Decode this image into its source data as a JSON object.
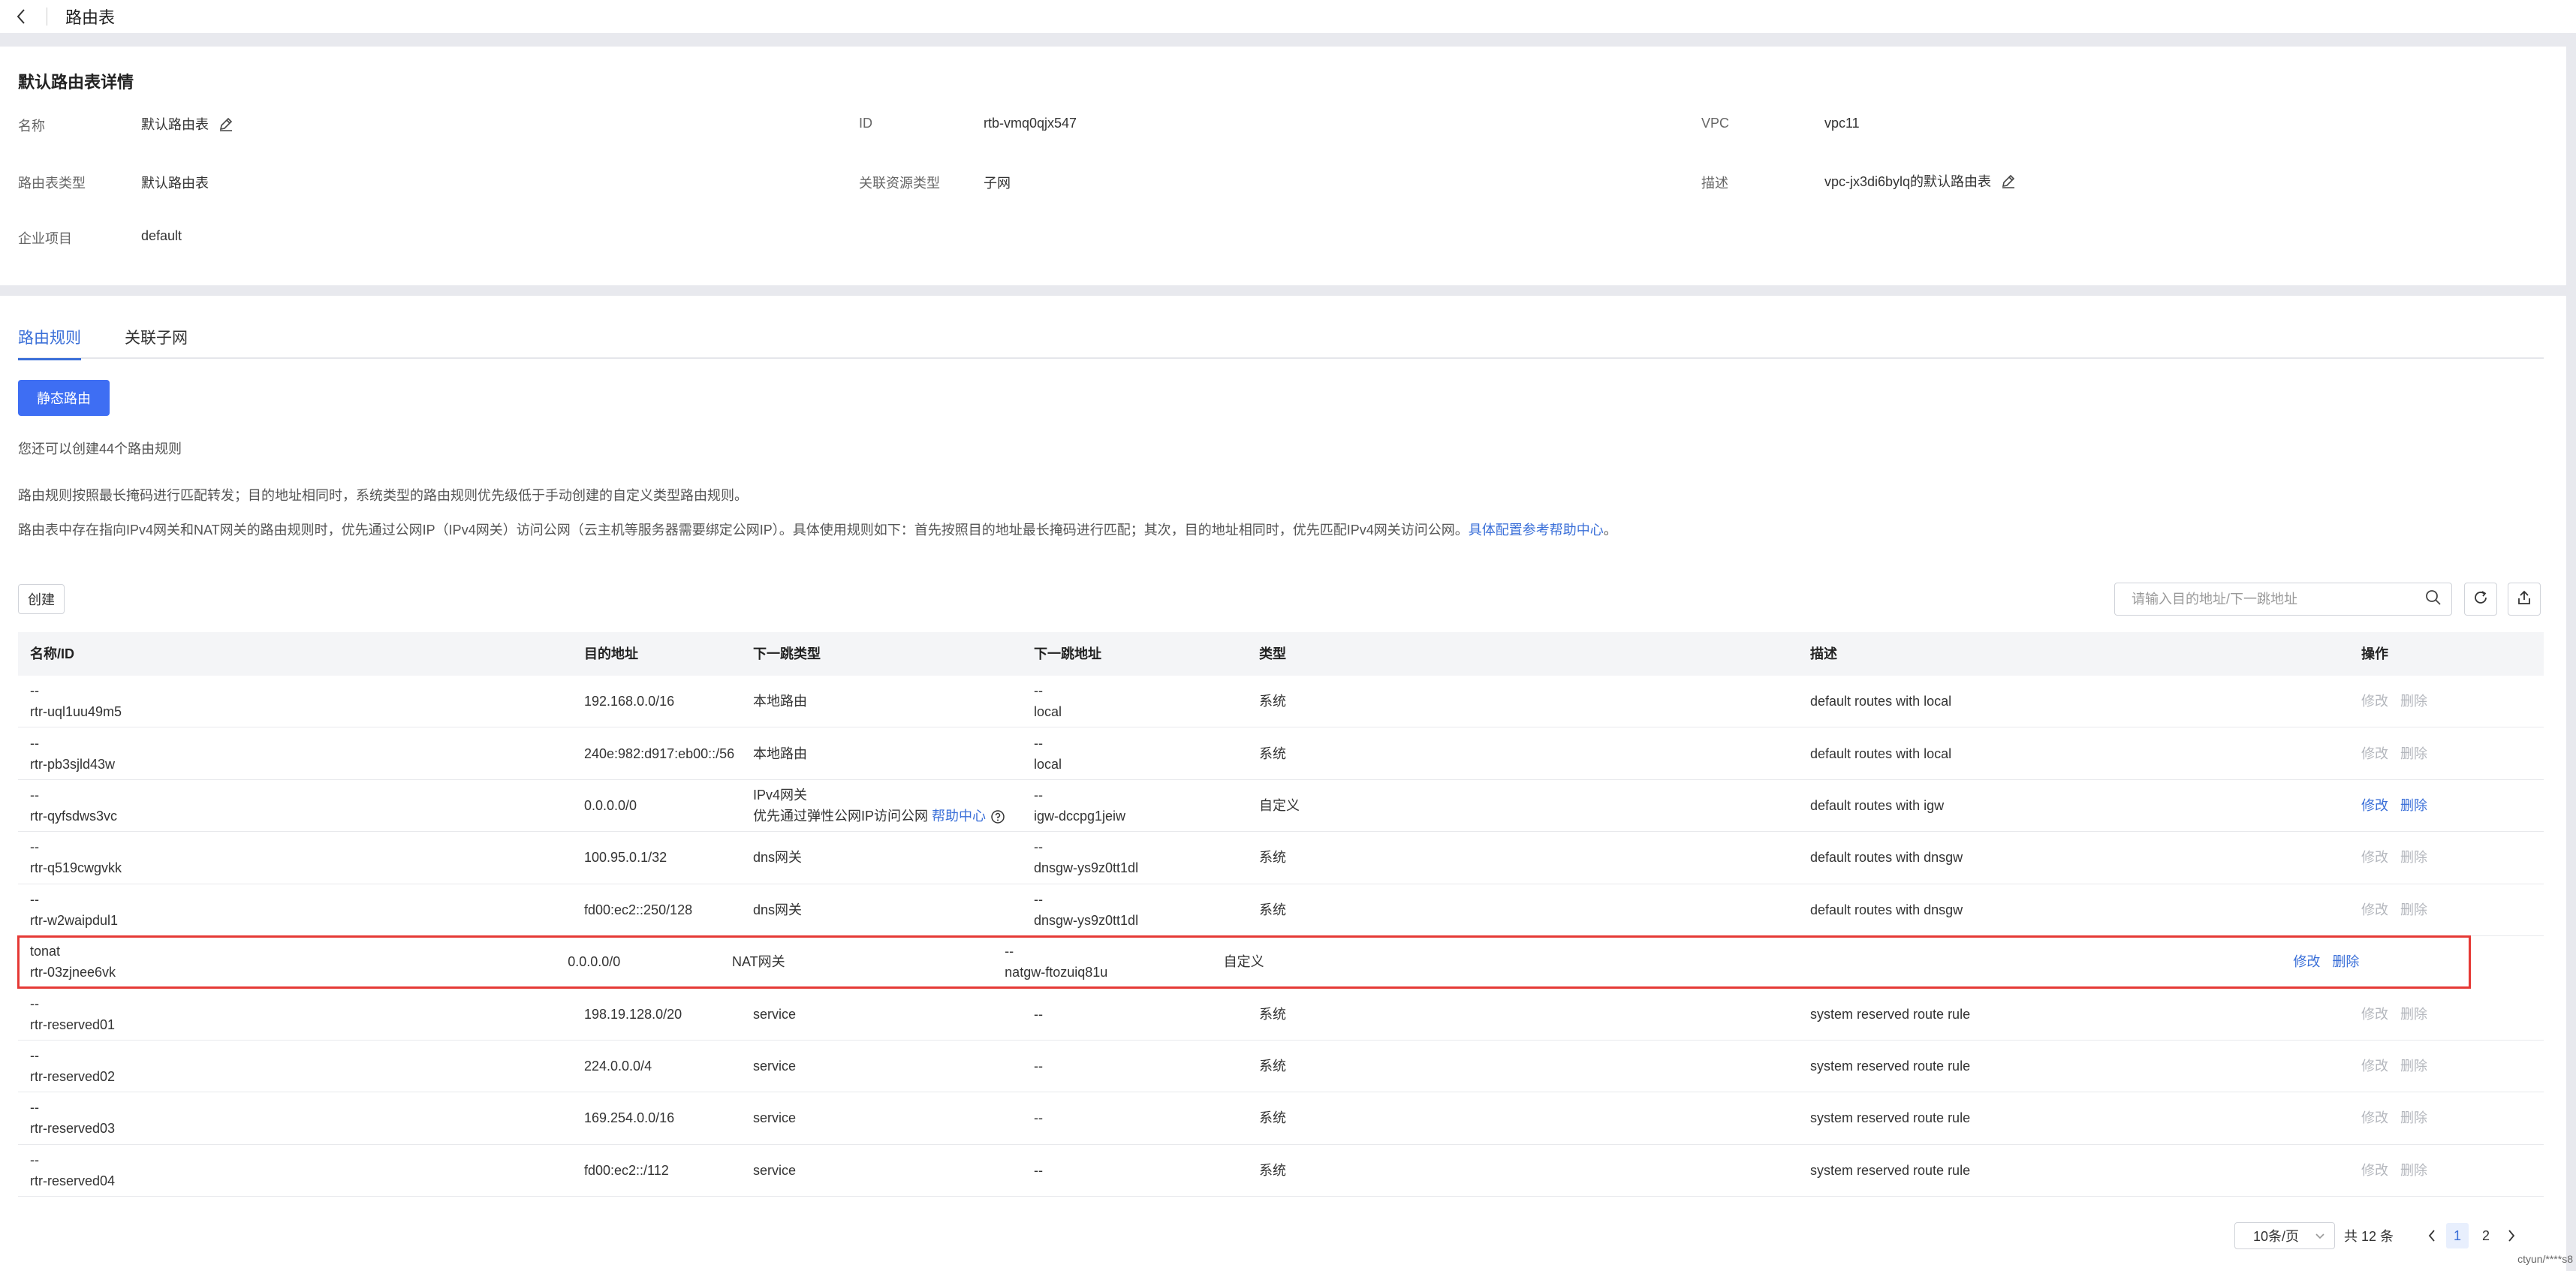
{
  "header": {
    "title": "路由表"
  },
  "detail": {
    "title": "默认路由表详情",
    "name_label": "名称",
    "name_value": "默认路由表",
    "id_label": "ID",
    "id_value": "rtb-vmq0qjx547",
    "vpc_label": "VPC",
    "vpc_value": "vpc11",
    "type_label": "路由表类型",
    "type_value": "默认路由表",
    "res_label": "关联资源类型",
    "res_value": "子网",
    "desc_label": "描述",
    "desc_value": "vpc-jx3di6bylq的默认路由表",
    "proj_label": "企业项目",
    "proj_value": "default"
  },
  "tabs": [
    {
      "label": "路由规则",
      "active": true
    },
    {
      "label": "关联子网",
      "active": false
    }
  ],
  "static_route_button": "静态路由",
  "quota_text": "您还可以创建44个路由规则",
  "info_line1": "路由规则按照最长掩码进行匹配转发；目的地址相同时，系统类型的路由规则优先级低于手动创建的自定义类型路由规则。",
  "info_line2": "路由表中存在指向IPv4网关和NAT网关的路由规则时，优先通过公网IP（IPv4网关）访问公网（云主机等服务器需要绑定公网IP）。具体使用规则如下：首先按照目的地址最长掩码进行匹配；其次，目的地址相同时，优先匹配IPv4网关访问公网。",
  "info_link": "具体配置参考帮助中心",
  "info_end": "。",
  "create_button": "创建",
  "search_placeholder": "请输入目的地址/下一跳地址",
  "table": {
    "headers": [
      "名称/ID",
      "目的地址",
      "下一跳类型",
      "下一跳地址",
      "类型",
      "描述",
      "操作"
    ],
    "edit_label": "修改",
    "delete_label": "删除",
    "rows": [
      {
        "name": "--",
        "id": "rtr-uql1uu49m5",
        "dest": "192.168.0.0/16",
        "nexthop_type": "本地路由",
        "nexthop_type2": "",
        "nh_name": "--",
        "nh_addr": "local",
        "type": "系统",
        "desc": "default routes with local",
        "editable": false
      },
      {
        "name": "--",
        "id": "rtr-pb3sjld43w",
        "dest": "240e:982:d917:eb00::/56",
        "nexthop_type": "本地路由",
        "nexthop_type2": "",
        "nh_name": "--",
        "nh_addr": "local",
        "type": "系统",
        "desc": "default routes with local",
        "editable": false
      },
      {
        "name": "--",
        "id": "rtr-qyfsdws3vc",
        "dest": "0.0.0.0/0",
        "nexthop_type": "IPv4网关",
        "nexthop_type2": "优先通过弹性公网IP访问公网",
        "help": "帮助中心",
        "nh_name": "--",
        "nh_addr": "igw-dccpg1jeiw",
        "type": "自定义",
        "desc": "default routes with igw",
        "editable": true
      },
      {
        "name": "--",
        "id": "rtr-q519cwgvkk",
        "dest": "100.95.0.1/32",
        "nexthop_type": "dns网关",
        "nexthop_type2": "",
        "nh_name": "--",
        "nh_addr": "dnsgw-ys9z0tt1dl",
        "type": "系统",
        "desc": "default routes with dnsgw",
        "editable": false
      },
      {
        "name": "--",
        "id": "rtr-w2waipdul1",
        "dest": "fd00:ec2::250/128",
        "nexthop_type": "dns网关",
        "nexthop_type2": "",
        "nh_name": "--",
        "nh_addr": "dnsgw-ys9z0tt1dl",
        "type": "系统",
        "desc": "default routes with dnsgw",
        "editable": false
      },
      {
        "name": "tonat",
        "id": "rtr-03zjnee6vk",
        "dest": "0.0.0.0/0",
        "nexthop_type": "NAT网关",
        "nexthop_type2": "",
        "nh_name": "--",
        "nh_addr": "natgw-ftozuiq81u",
        "type": "自定义",
        "desc": "",
        "editable": true,
        "highlight": true
      },
      {
        "name": "--",
        "id": "rtr-reserved01",
        "dest": "198.19.128.0/20",
        "nexthop_type": "service",
        "nexthop_type2": "",
        "nh_name": "--",
        "nh_addr": "",
        "type": "系统",
        "desc": "system reserved route rule",
        "editable": false
      },
      {
        "name": "--",
        "id": "rtr-reserved02",
        "dest": "224.0.0.0/4",
        "nexthop_type": "service",
        "nexthop_type2": "",
        "nh_name": "--",
        "nh_addr": "",
        "type": "系统",
        "desc": "system reserved route rule",
        "editable": false
      },
      {
        "name": "--",
        "id": "rtr-reserved03",
        "dest": "169.254.0.0/16",
        "nexthop_type": "service",
        "nexthop_type2": "",
        "nh_name": "--",
        "nh_addr": "",
        "type": "系统",
        "desc": "system reserved route rule",
        "editable": false
      },
      {
        "name": "--",
        "id": "rtr-reserved04",
        "dest": "fd00:ec2::/112",
        "nexthop_type": "service",
        "nexthop_type2": "",
        "nh_name": "--",
        "nh_addr": "",
        "type": "系统",
        "desc": "system reserved route rule",
        "editable": false
      }
    ]
  },
  "pagination": {
    "page_size": "10条/页",
    "total": "共 12 条",
    "pages": [
      "1",
      "2"
    ],
    "current": "1"
  },
  "watermark": "ctyun/****s8",
  "colors": {
    "primary": "#3e6ef3",
    "link": "#3a6fd8",
    "highlight_border": "#e53935"
  }
}
